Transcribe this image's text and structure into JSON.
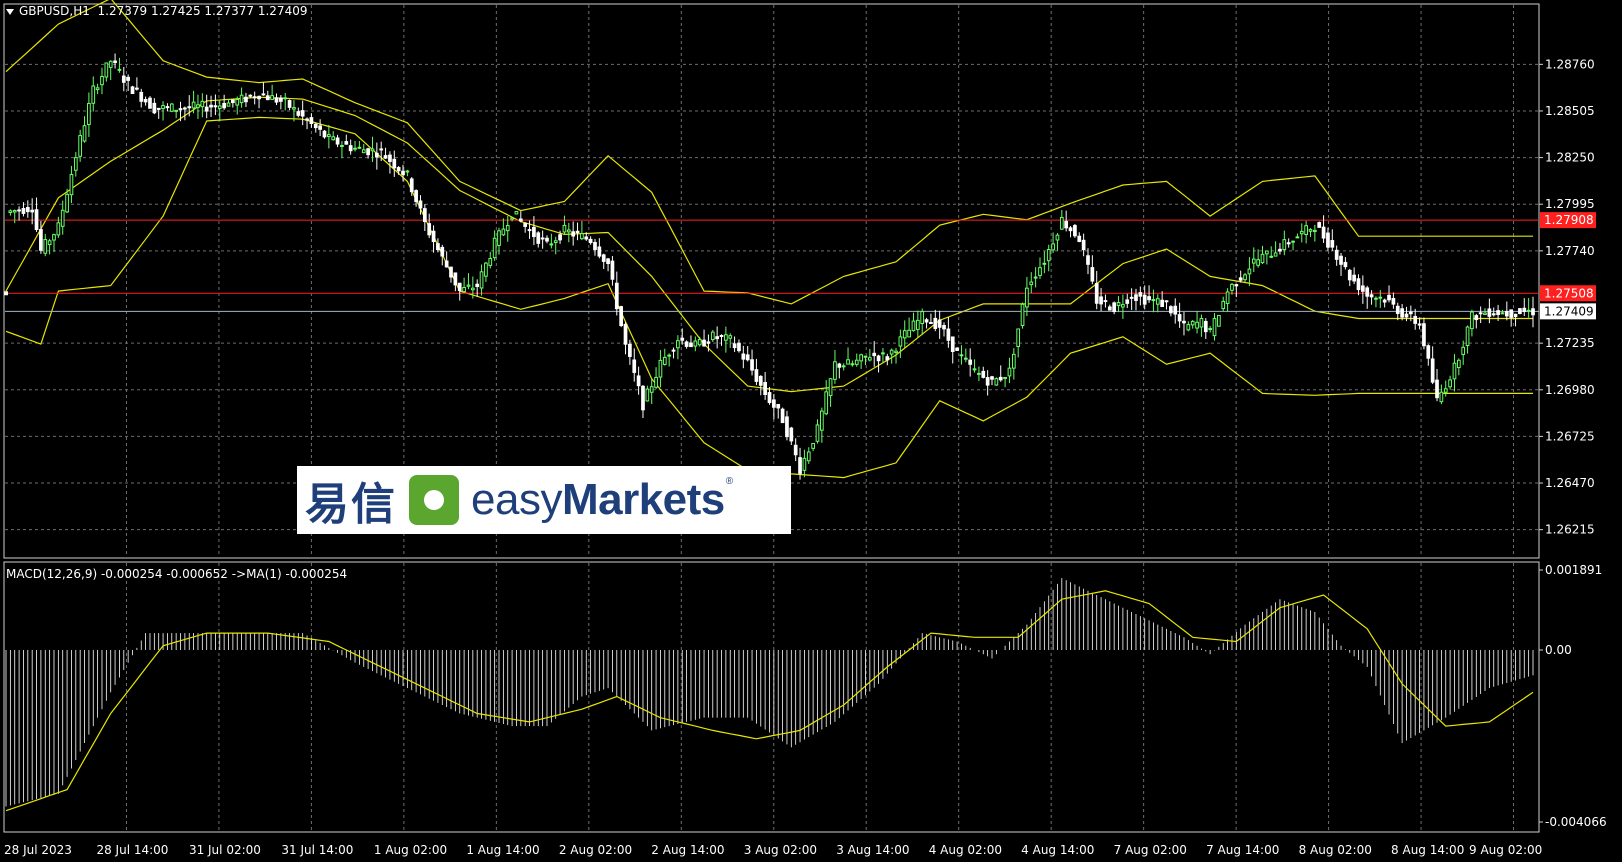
{
  "header": {
    "symbol": "GBPUSD,H1",
    "ohlc": "1.27379 1.27425 1.27377 1.27409"
  },
  "macd_header": {
    "text": "MACD(12,26,9) -0.000254 -0.000652  ->MA(1) -0.000254"
  },
  "logo": {
    "cn": "易信",
    "en_prefix": "easy",
    "en_bold": "Markets",
    "reg": "®"
  },
  "colors": {
    "background": "#000000",
    "grid": "#6e6e6e",
    "bull": "#66ff66",
    "bear": "#ffffff",
    "bands": "#e6e600",
    "resistance": "#ff2020",
    "current_price_line": "#9fb6c8",
    "macd_hist": "#ffffff",
    "macd_signal": "#e6e600"
  },
  "chart_data": {
    "type": "candlestick",
    "symbol": "GBPUSD",
    "timeframe": "H1",
    "price_axis_ticks": [
      "1.28760",
      "1.28505",
      "1.28250",
      "1.27995",
      "1.27740",
      "1.27235",
      "1.26980",
      "1.26725",
      "1.26470",
      "1.26215"
    ],
    "price_ylim": [
      1.2606,
      1.2909
    ],
    "time_axis_labels": [
      "28 Jul 2023",
      "28 Jul 14:00",
      "31 Jul 02:00",
      "31 Jul 14:00",
      "1 Aug 02:00",
      "1 Aug 14:00",
      "2 Aug 02:00",
      "2 Aug 14:00",
      "3 Aug 02:00",
      "3 Aug 14:00",
      "4 Aug 02:00",
      "4 Aug 14:00",
      "7 Aug 02:00",
      "7 Aug 14:00",
      "8 Aug 02:00",
      "8 Aug 14:00",
      "9 Aug 02:00"
    ],
    "horizontal_levels": [
      {
        "label": "1.27908",
        "price": 1.27908,
        "color": "#ff2020"
      },
      {
        "label": "1.27508",
        "price": 1.27508,
        "color": "#ff2020"
      }
    ],
    "current_price": {
      "label": "1.27409",
      "price": 1.27409
    },
    "bollinger_upper": [
      [
        0,
        1.2872
      ],
      [
        12,
        1.2898
      ],
      [
        24,
        1.2912
      ],
      [
        36,
        1.2878
      ],
      [
        46,
        1.2869
      ],
      [
        58,
        1.2866
      ],
      [
        68,
        1.2868
      ],
      [
        80,
        1.2855
      ],
      [
        92,
        1.2844
      ],
      [
        104,
        1.2812
      ],
      [
        118,
        1.2796
      ],
      [
        128,
        1.2801
      ],
      [
        138,
        1.2826
      ],
      [
        148,
        1.2806
      ],
      [
        160,
        1.2752
      ],
      [
        170,
        1.2751
      ],
      [
        180,
        1.2745
      ],
      [
        192,
        1.276
      ],
      [
        204,
        1.2768
      ],
      [
        214,
        1.2788
      ],
      [
        224,
        1.2794
      ],
      [
        234,
        1.2791
      ],
      [
        244,
        1.28
      ],
      [
        256,
        1.281
      ],
      [
        266,
        1.2812
      ],
      [
        276,
        1.2793
      ],
      [
        288,
        1.2812
      ],
      [
        300,
        1.2815
      ],
      [
        310,
        1.2782
      ]
    ],
    "bollinger_middle": [
      [
        0,
        1.2752
      ],
      [
        12,
        1.2803
      ],
      [
        24,
        1.2823
      ],
      [
        36,
        1.284
      ],
      [
        46,
        1.2856
      ],
      [
        58,
        1.2858
      ],
      [
        68,
        1.2857
      ],
      [
        80,
        1.2848
      ],
      [
        92,
        1.2833
      ],
      [
        104,
        1.2807
      ],
      [
        118,
        1.279
      ],
      [
        128,
        1.2783
      ],
      [
        138,
        1.2784
      ],
      [
        148,
        1.276
      ],
      [
        160,
        1.2723
      ],
      [
        170,
        1.27
      ],
      [
        180,
        1.2697
      ],
      [
        192,
        1.27
      ],
      [
        204,
        1.2717
      ],
      [
        214,
        1.2736
      ],
      [
        224,
        1.2745
      ],
      [
        234,
        1.2745
      ],
      [
        244,
        1.2745
      ],
      [
        256,
        1.2767
      ],
      [
        266,
        1.2775
      ],
      [
        276,
        1.276
      ],
      [
        288,
        1.2755
      ],
      [
        300,
        1.2741
      ],
      [
        310,
        1.2737
      ]
    ],
    "bollinger_lower": [
      [
        0,
        1.273
      ],
      [
        8,
        1.2723
      ],
      [
        12,
        1.2752
      ],
      [
        24,
        1.2755
      ],
      [
        36,
        1.2793
      ],
      [
        46,
        1.2845
      ],
      [
        58,
        1.2847
      ],
      [
        68,
        1.2846
      ],
      [
        80,
        1.2838
      ],
      [
        92,
        1.2812
      ],
      [
        104,
        1.2752
      ],
      [
        118,
        1.2742
      ],
      [
        128,
        1.2748
      ],
      [
        138,
        1.2756
      ],
      [
        148,
        1.2704
      ],
      [
        160,
        1.2669
      ],
      [
        170,
        1.2654
      ],
      [
        180,
        1.2652
      ],
      [
        192,
        1.265
      ],
      [
        204,
        1.2658
      ],
      [
        214,
        1.2692
      ],
      [
        224,
        1.2681
      ],
      [
        234,
        1.2694
      ],
      [
        244,
        1.2718
      ],
      [
        256,
        1.2727
      ],
      [
        266,
        1.2712
      ],
      [
        276,
        1.2718
      ],
      [
        288,
        1.2696
      ],
      [
        300,
        1.2695
      ],
      [
        310,
        1.2696
      ]
    ],
    "close_path": [
      [
        0,
        1.2795
      ],
      [
        6,
        1.2798
      ],
      [
        8,
        1.2774
      ],
      [
        12,
        1.2787
      ],
      [
        16,
        1.2826
      ],
      [
        20,
        1.2862
      ],
      [
        24,
        1.2878
      ],
      [
        28,
        1.2865
      ],
      [
        34,
        1.2852
      ],
      [
        40,
        1.2852
      ],
      [
        46,
        1.2853
      ],
      [
        52,
        1.2855
      ],
      [
        58,
        1.286
      ],
      [
        64,
        1.2855
      ],
      [
        68,
        1.2847
      ],
      [
        74,
        1.2835
      ],
      [
        80,
        1.283
      ],
      [
        86,
        1.2828
      ],
      [
        92,
        1.2815
      ],
      [
        96,
        1.2789
      ],
      [
        100,
        1.277
      ],
      [
        104,
        1.2752
      ],
      [
        108,
        1.2755
      ],
      [
        112,
        1.2778
      ],
      [
        116,
        1.2795
      ],
      [
        120,
        1.2785
      ],
      [
        124,
        1.2777
      ],
      [
        128,
        1.2785
      ],
      [
        134,
        1.278
      ],
      [
        138,
        1.2767
      ],
      [
        142,
        1.2722
      ],
      [
        146,
        1.269
      ],
      [
        150,
        1.2712
      ],
      [
        154,
        1.2726
      ],
      [
        158,
        1.2722
      ],
      [
        162,
        1.2727
      ],
      [
        166,
        1.2725
      ],
      [
        170,
        1.2713
      ],
      [
        174,
        1.2696
      ],
      [
        178,
        1.2682
      ],
      [
        182,
        1.2655
      ],
      [
        186,
        1.2676
      ],
      [
        190,
        1.2712
      ],
      [
        194,
        1.2712
      ],
      [
        198,
        1.2717
      ],
      [
        202,
        1.2716
      ],
      [
        206,
        1.2728
      ],
      [
        210,
        1.2738
      ],
      [
        214,
        1.2733
      ],
      [
        218,
        1.2718
      ],
      [
        222,
        1.2708
      ],
      [
        226,
        1.2702
      ],
      [
        230,
        1.2708
      ],
      [
        234,
        1.2755
      ],
      [
        238,
        1.2769
      ],
      [
        242,
        1.2791
      ],
      [
        246,
        1.2781
      ],
      [
        250,
        1.2747
      ],
      [
        254,
        1.2743
      ],
      [
        258,
        1.275
      ],
      [
        262,
        1.2747
      ],
      [
        266,
        1.2745
      ],
      [
        270,
        1.2732
      ],
      [
        274,
        1.2735
      ],
      [
        276,
        1.2729
      ],
      [
        280,
        1.2752
      ],
      [
        286,
        1.2768
      ],
      [
        290,
        1.2773
      ],
      [
        296,
        1.2782
      ],
      [
        300,
        1.2788
      ],
      [
        304,
        1.2776
      ],
      [
        308,
        1.276
      ],
      [
        312,
        1.275
      ],
      [
        316,
        1.2748
      ],
      [
        320,
        1.274
      ],
      [
        324,
        1.2734
      ],
      [
        328,
        1.2692
      ],
      [
        332,
        1.271
      ],
      [
        336,
        1.2738
      ],
      [
        340,
        1.2741
      ],
      [
        344,
        1.274
      ],
      [
        348,
        1.2741
      ],
      [
        350,
        1.2741
      ]
    ],
    "macd_ylim": [
      -0.004066,
      0.001891
    ],
    "macd_ticks": [
      "0.001891",
      "0.00",
      "-0.004066"
    ],
    "macd_hist": [
      [
        0,
        -0.0037
      ],
      [
        12,
        -0.0034
      ],
      [
        24,
        -0.001
      ],
      [
        32,
        0.0004
      ],
      [
        40,
        0.0004
      ],
      [
        56,
        0.0004
      ],
      [
        68,
        0.0004
      ],
      [
        80,
        -0.0003
      ],
      [
        92,
        -0.0009
      ],
      [
        104,
        -0.0015
      ],
      [
        116,
        -0.0018
      ],
      [
        124,
        -0.0018
      ],
      [
        132,
        -0.0011
      ],
      [
        138,
        -0.0009
      ],
      [
        148,
        -0.0019
      ],
      [
        160,
        -0.0016
      ],
      [
        170,
        -0.0016
      ],
      [
        180,
        -0.0023
      ],
      [
        190,
        -0.0017
      ],
      [
        200,
        -0.0008
      ],
      [
        210,
        0.0004
      ],
      [
        218,
        0.0002
      ],
      [
        226,
        -0.0002
      ],
      [
        234,
        0.0006
      ],
      [
        242,
        0.0017
      ],
      [
        252,
        0.0012
      ],
      [
        262,
        0.0007
      ],
      [
        270,
        0.0003
      ],
      [
        276,
        -0.0001
      ],
      [
        284,
        0.0006
      ],
      [
        292,
        0.0012
      ],
      [
        300,
        0.0009
      ],
      [
        306,
        0.0001
      ],
      [
        312,
        -0.0004
      ],
      [
        320,
        -0.0022
      ],
      [
        330,
        -0.0016
      ],
      [
        340,
        -0.0009
      ],
      [
        350,
        -0.0006
      ]
    ],
    "macd_signal": [
      [
        0,
        -0.0038
      ],
      [
        14,
        -0.0033
      ],
      [
        24,
        -0.0015
      ],
      [
        36,
        0.0001
      ],
      [
        46,
        0.0004
      ],
      [
        60,
        0.0004
      ],
      [
        74,
        0.0002
      ],
      [
        84,
        -0.0003
      ],
      [
        96,
        -0.0009
      ],
      [
        108,
        -0.0015
      ],
      [
        120,
        -0.0017
      ],
      [
        132,
        -0.0014
      ],
      [
        140,
        -0.0011
      ],
      [
        150,
        -0.0016
      ],
      [
        162,
        -0.0019
      ],
      [
        172,
        -0.0021
      ],
      [
        182,
        -0.0019
      ],
      [
        192,
        -0.0013
      ],
      [
        202,
        -0.0004
      ],
      [
        212,
        0.0004
      ],
      [
        222,
        0.0003
      ],
      [
        232,
        0.0003
      ],
      [
        242,
        0.0012
      ],
      [
        252,
        0.0014
      ],
      [
        262,
        0.0011
      ],
      [
        272,
        0.0003
      ],
      [
        282,
        0.0002
      ],
      [
        292,
        0.001
      ],
      [
        302,
        0.0013
      ],
      [
        312,
        0.0005
      ],
      [
        320,
        -0.0008
      ],
      [
        330,
        -0.0018
      ],
      [
        340,
        -0.0017
      ],
      [
        350,
        -0.001
      ]
    ]
  }
}
